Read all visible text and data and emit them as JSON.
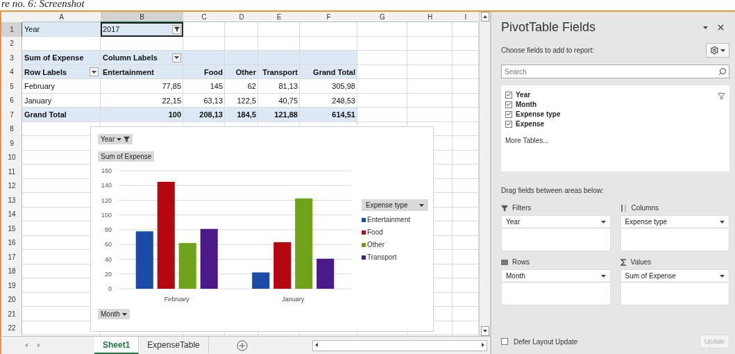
{
  "caption": "re no. 6: Screenshot",
  "sheet": {
    "columns": [
      {
        "label": "A",
        "selected": false
      },
      {
        "label": "B",
        "selected": true
      },
      {
        "label": "C",
        "selected": false
      },
      {
        "label": "D",
        "selected": false
      },
      {
        "label": "E",
        "selected": false
      },
      {
        "label": "F",
        "selected": false
      },
      {
        "label": "G",
        "selected": false
      },
      {
        "label": "H",
        "selected": false
      },
      {
        "label": "I",
        "selected": false
      }
    ],
    "rows": [
      {
        "number": "1",
        "kind": "filter",
        "selected": true,
        "cells": [
          "Year",
          "2017"
        ]
      },
      {
        "number": "2",
        "kind": "empty",
        "selected": false
      },
      {
        "number": "3",
        "kind": "caption",
        "selected": false,
        "cells": [
          "Sum of Expense",
          "Column Labels"
        ]
      },
      {
        "number": "4",
        "kind": "header",
        "selected": false,
        "cells": [
          "Row Labels",
          "Entertainment",
          "Food",
          "Other",
          "Transport",
          "Grand Total"
        ]
      },
      {
        "number": "5",
        "kind": "data",
        "selected": false,
        "cells": [
          "February",
          "77,85",
          "145",
          "62",
          "81,13",
          "305,98"
        ]
      },
      {
        "number": "6",
        "kind": "data",
        "selected": false,
        "cells": [
          "January",
          "22,15",
          "63,13",
          "122,5",
          "40,75",
          "248,53"
        ]
      },
      {
        "number": "7",
        "kind": "total",
        "selected": false,
        "cells": [
          "Grand Total",
          "100",
          "208,13",
          "184,5",
          "121,88",
          "614,51"
        ]
      },
      {
        "number": "8",
        "kind": "empty",
        "selected": false
      },
      {
        "number": "9",
        "kind": "empty",
        "selected": false
      },
      {
        "number": "10",
        "kind": "empty",
        "selected": false
      },
      {
        "number": "11",
        "kind": "empty",
        "selected": false
      },
      {
        "number": "12",
        "kind": "empty",
        "selected": false
      },
      {
        "number": "13",
        "kind": "empty",
        "selected": false
      },
      {
        "number": "14",
        "kind": "empty",
        "selected": false
      },
      {
        "number": "15",
        "kind": "empty",
        "selected": false
      },
      {
        "number": "16",
        "kind": "empty",
        "selected": false
      },
      {
        "number": "17",
        "kind": "empty",
        "selected": false
      },
      {
        "number": "18",
        "kind": "empty",
        "selected": false
      },
      {
        "number": "19",
        "kind": "empty",
        "selected": false
      },
      {
        "number": "20",
        "kind": "empty",
        "selected": false
      },
      {
        "number": "21",
        "kind": "empty",
        "selected": false
      },
      {
        "number": "22",
        "kind": "empty",
        "selected": false
      }
    ]
  },
  "pivot_chart": {
    "filter_button": "Year",
    "value_label": "Sum of Expense",
    "legend_button": "Expense type",
    "axis_button": "Month",
    "chart_data": {
      "type": "bar",
      "grid": true,
      "categories": [
        "February",
        "January"
      ],
      "ylim": [
        0,
        160
      ],
      "yticks": [
        0,
        20,
        40,
        60,
        80,
        100,
        120,
        140,
        160
      ],
      "series": [
        {
          "name": "Entertainment",
          "color": "#1a4ba6",
          "values": [
            77.85,
            22.15
          ]
        },
        {
          "name": "Food",
          "color": "#b5070f",
          "values": [
            145,
            63.13
          ]
        },
        {
          "name": "Other",
          "color": "#70a21b",
          "values": [
            62,
            122.5
          ]
        },
        {
          "name": "Transport",
          "color": "#4a1a86",
          "values": [
            81.13,
            40.75
          ]
        }
      ]
    }
  },
  "sheet_tabs": [
    {
      "label": "Sheet1",
      "selected": true
    },
    {
      "label": "ExpenseTable",
      "selected": false
    }
  ],
  "pivot_fields": {
    "title": "PivotTable Fields",
    "subtitle": "Choose fields to add to report:",
    "search": {
      "placeholder": "Search"
    },
    "fields": [
      {
        "label": "Year",
        "checked": true
      },
      {
        "label": "Month",
        "checked": true
      },
      {
        "label": "Expense type",
        "checked": true
      },
      {
        "label": "Expense",
        "checked": true
      }
    ],
    "more_tables": "More Tables...",
    "areas_hint": "Drag fields between areas below:",
    "areas": [
      {
        "kind": "filters",
        "label": "Filters",
        "items": [
          "Year"
        ]
      },
      {
        "kind": "columns",
        "label": "Columns",
        "items": [
          "Expense type"
        ]
      },
      {
        "kind": "rows",
        "label": "Rows",
        "items": [
          "Month"
        ]
      },
      {
        "kind": "values",
        "label": "Values",
        "items": [
          "Sum of Expense"
        ]
      }
    ],
    "defer": {
      "label": "Defer Layout Update",
      "checked": false
    },
    "update_button": {
      "label": "Update",
      "disabled": true
    }
  }
}
